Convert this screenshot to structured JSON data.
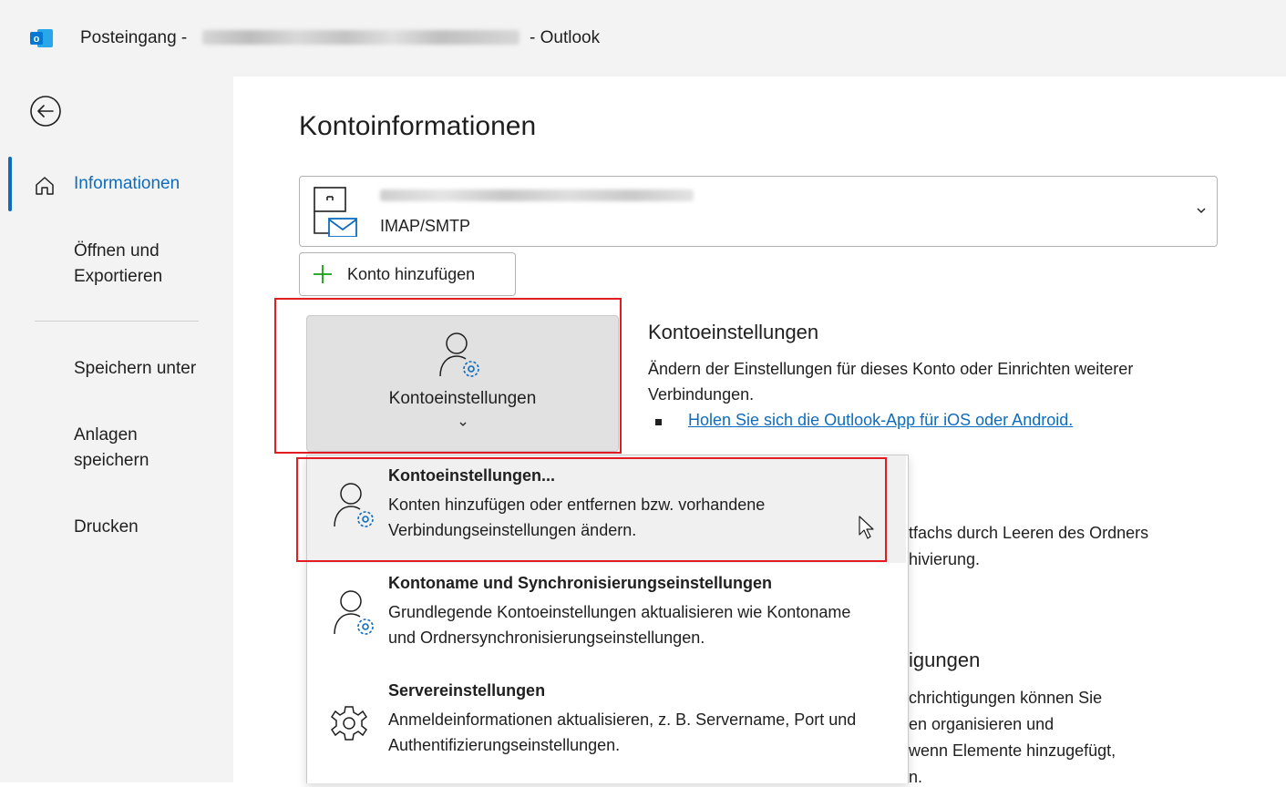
{
  "titlebar": {
    "prefix": "Posteingang -",
    "suffix": "- Outlook",
    "app_icon_letter": "o"
  },
  "sidebar": {
    "items": [
      {
        "label": "Informationen",
        "active": true
      },
      {
        "label": "Öffnen und Exportieren"
      },
      {
        "label": "Speichern unter"
      },
      {
        "label": "Anlagen speichern"
      },
      {
        "label": "Drucken"
      }
    ]
  },
  "main": {
    "title": "Kontoinformationen",
    "account": {
      "type": "IMAP/SMTP"
    },
    "add_account_label": "Konto hinzufügen",
    "big_button_label": "Kontoeinstellungen",
    "section": {
      "title": "Kontoeinstellungen",
      "description": "Ändern der Einstellungen für dieses Konto oder Einrichten weiterer Verbindungen.",
      "link": "Holen Sie sich die Outlook-App für iOS oder Android."
    },
    "background_fragments": [
      "tfachs durch Leeren des Ordners",
      "hivierung.",
      "igungen",
      "chrichtigungen können Sie",
      "en organisieren und",
      "wenn Elemente hinzugefügt,",
      "n."
    ]
  },
  "dropdown": {
    "items": [
      {
        "title": "Kontoeinstellungen...",
        "access_key": "i",
        "description": "Konten hinzufügen oder entfernen bzw. vorhandene Verbindungseinstellungen ändern."
      },
      {
        "title": "Kontoname und Synchronisierungseinstellungen",
        "access_key": "n",
        "description": "Grundlegende Kontoeinstellungen aktualisieren wie Kontoname und Ordnersynchronisierungseinstellungen."
      },
      {
        "title": "Servereinstellungen",
        "access_key": "S",
        "description": "Anmeldeinformationen aktualisieren, z. B. Servername, Port und Authentifizierungseinstellungen."
      }
    ]
  },
  "colors": {
    "accent": "#0f6cbd",
    "highlight_red": "#e31b23",
    "sidebar_bg": "#f3f3f3",
    "plus_green": "#13a10e"
  }
}
